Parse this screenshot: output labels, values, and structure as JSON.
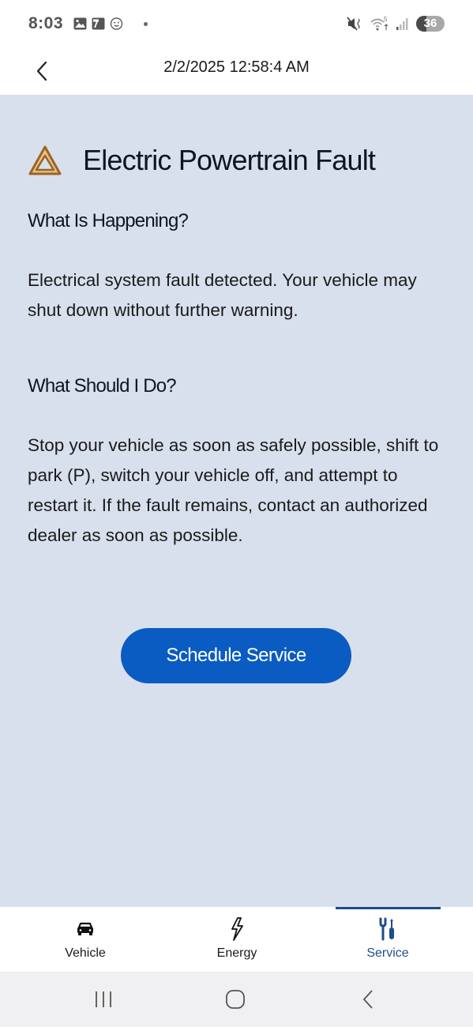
{
  "status_bar": {
    "time": "8:03",
    "left_icons": [
      "gallery-icon",
      "calendar-icon",
      "emoji-icon",
      "notification-dot"
    ],
    "right_icons": [
      "mute-vibrate-icon",
      "wifi-5g-icon",
      "cell-signal-icon"
    ],
    "battery_level": "36"
  },
  "header": {
    "back_icon": "chevron-left-icon",
    "title": "2/2/2025 12:58:4 AM"
  },
  "alert": {
    "icon": "warning-triangle-icon",
    "icon_color": "#b8782a",
    "title": "Electric Powertrain Fault",
    "sections": [
      {
        "heading": "What Is Happening?",
        "body": "Electrical system fault detected. Your vehicle may shut down without further warning."
      },
      {
        "heading": "What Should I Do?",
        "body": "Stop your vehicle as soon as safely possible, shift to park (P), switch your vehicle off, and attempt to restart it. If the fault remains, contact an authorized dealer as soon as possible."
      }
    ],
    "action_button": "Schedule Service"
  },
  "colors": {
    "content_bg": "#d9e0ed",
    "primary_button": "#0a5cc2",
    "active_tab": "#1c4d8c"
  },
  "tabs": [
    {
      "label": "Vehicle",
      "icon": "car-icon",
      "active": false
    },
    {
      "label": "Energy",
      "icon": "lightning-icon",
      "active": false
    },
    {
      "label": "Service",
      "icon": "wrench-screwdriver-icon",
      "active": true
    }
  ],
  "system_nav": {
    "buttons": [
      "recent-apps",
      "home",
      "back"
    ]
  }
}
